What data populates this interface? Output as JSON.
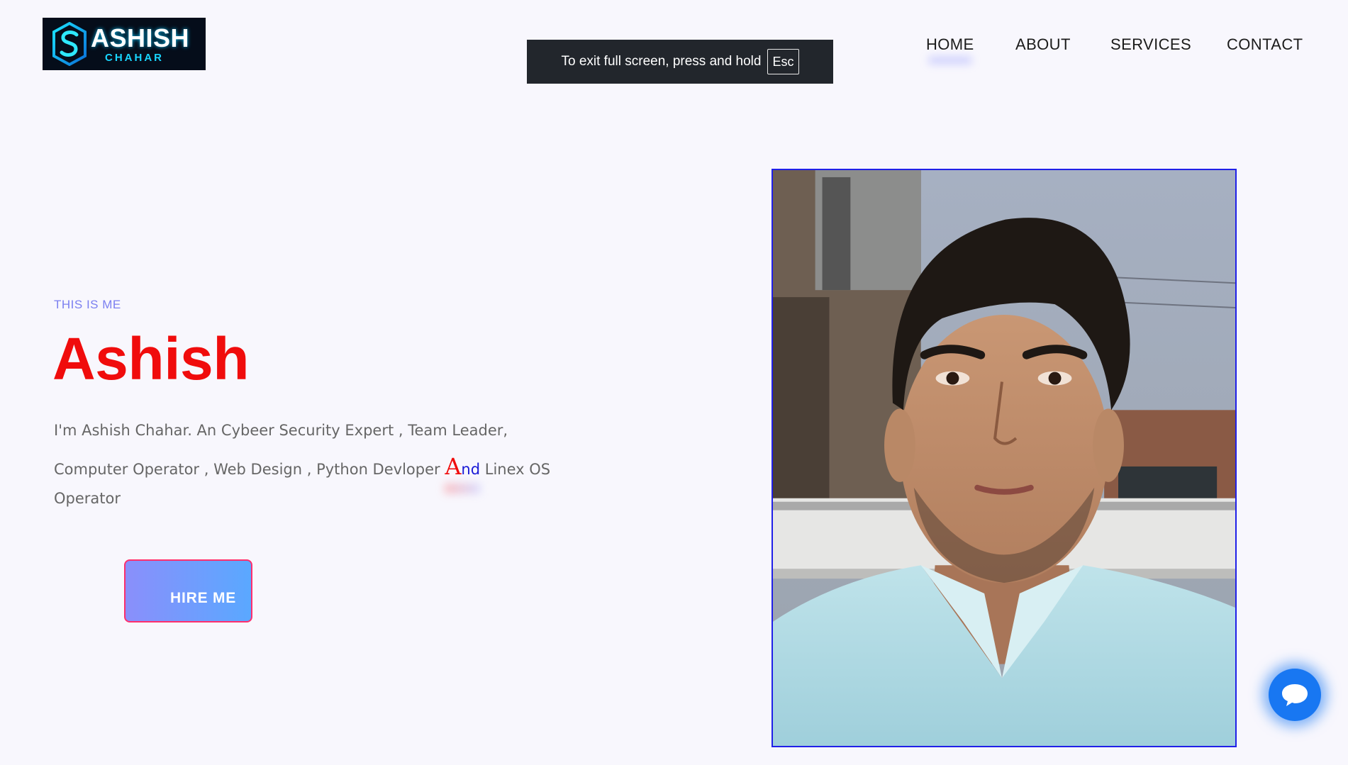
{
  "header": {
    "logo": {
      "name": "ASHISH",
      "sub": "CHAHAR"
    },
    "nav": [
      {
        "label": "HOME",
        "active": true
      },
      {
        "label": "ABOUT"
      },
      {
        "label": "SERVICES"
      },
      {
        "label": "CONTACT"
      }
    ]
  },
  "fullscreen_notice": {
    "text": "To exit full screen, press and hold",
    "key": "Esc"
  },
  "hero": {
    "eyebrow": "THIS IS ME",
    "name": "Ashish",
    "bio_line1": "I'm Ashish Chahar. An Cybeer Security Expert , Team Leader,",
    "bio_line2_before": "Computer Operator , Web Design , Python Devloper ",
    "bio_highlight_letter": "A",
    "bio_highlight_rest": "nd",
    "bio_line2_after": " Linex OS",
    "bio_line3": "Operator",
    "cta_label": "HIRE ME"
  },
  "icons": {
    "chat": "chat-bubble-icon",
    "logo": "shield-s-logo-icon"
  },
  "colors": {
    "accent_red": "#f00c0c",
    "eyebrow": "#7b7ff0",
    "chat_button": "#1877f2",
    "portrait_border": "#2020e8"
  }
}
